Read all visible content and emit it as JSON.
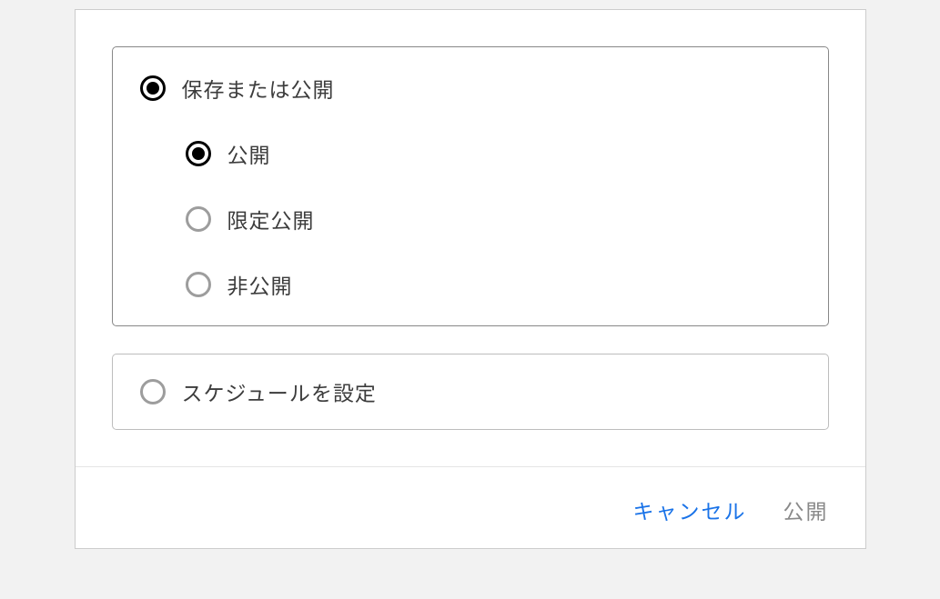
{
  "options": {
    "save_or_publish": {
      "label": "保存または公開",
      "selected": true,
      "sub": {
        "public": {
          "label": "公開",
          "selected": true
        },
        "unlisted": {
          "label": "限定公開",
          "selected": false
        },
        "private": {
          "label": "非公開",
          "selected": false
        }
      }
    },
    "schedule": {
      "label": "スケジュールを設定",
      "selected": false
    }
  },
  "footer": {
    "cancel": "キャンセル",
    "submit": "公開"
  }
}
